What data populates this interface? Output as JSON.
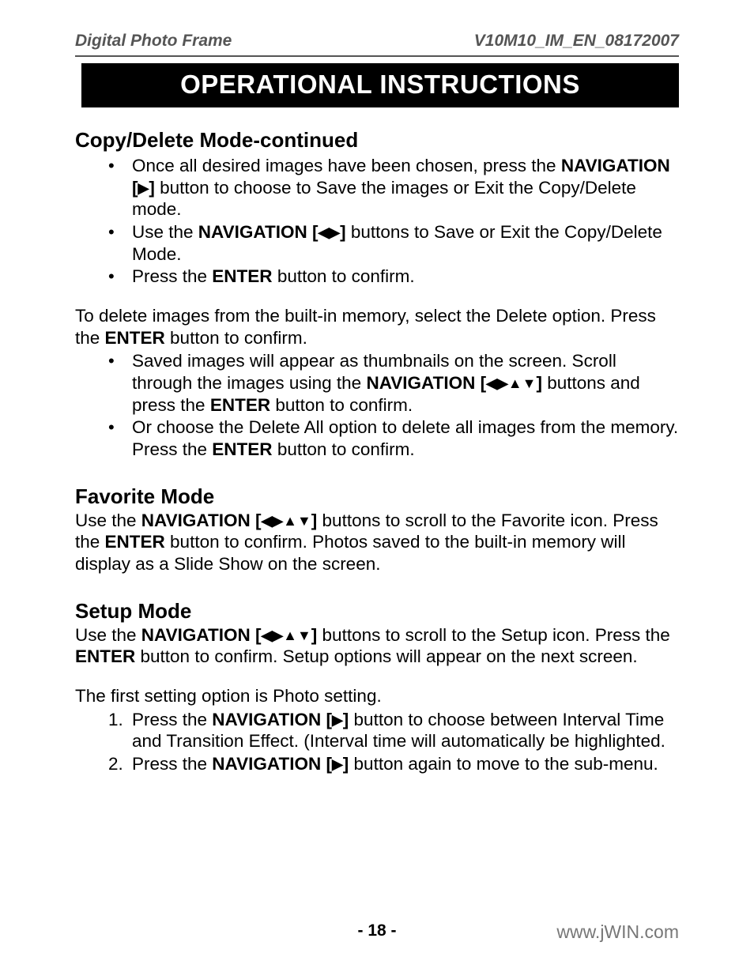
{
  "header": {
    "left": "Digital Photo Frame",
    "right": "V10M10_IM_EN_08172007"
  },
  "title": "OPERATIONAL INSTRUCTIONS",
  "s1": {
    "heading": "Copy/Delete Mode-continued",
    "b1a": "Once all desired images have been chosen, press the ",
    "b1b": "NAVIGATION [",
    "b1c": "]",
    "b1d": " button to choose to Save the images or Exit the Copy/Delete mode.",
    "b2a": "Use the ",
    "b2b": "NAVIGATION [",
    "b2c": "]",
    "b2d": " buttons to Save or Exit the Copy/Delete Mode.",
    "b3a": "Press the ",
    "b3b": "ENTER",
    "b3c": " button to confirm.",
    "p1a": "To delete images from the built-in memory, select the Delete option. Press the ",
    "p1b": "ENTER",
    "p1c": " button to confirm.",
    "b4a": "Saved images will appear as thumbnails on the screen. Scroll through the images using the ",
    "b4b": "NAVIGATION [",
    "b4c": "]",
    "b4d": " buttons and press the ",
    "b4e": "ENTER",
    "b4f": " button to confirm.",
    "b5a": "Or choose the Delete All option to delete all images from the memory. Press the ",
    "b5b": "ENTER",
    "b5c": " button to confirm."
  },
  "s2": {
    "heading": "Favorite Mode",
    "p1a": "Use the ",
    "p1b": "NAVIGATION [",
    "p1c": "]",
    "p1d": " buttons to scroll to the Favorite icon. Press the ",
    "p1e": "ENTER",
    "p1f": " button to confirm. Photos saved to the built-in memory will display as a Slide Show on the screen."
  },
  "s3": {
    "heading": "Setup Mode",
    "p1a": "Use the ",
    "p1b": "NAVIGATION [",
    "p1c": "]",
    "p1d": " buttons to scroll to the Setup icon. Press the ",
    "p1e": "ENTER",
    "p1f": " button to confirm. Setup options will appear on the next screen.",
    "p2": "The first setting option is Photo setting.",
    "n1num": "1.",
    "n1a": "Press the ",
    "n1b": "NAVIGATION [",
    "n1c": "]",
    "n1d": " button to choose between Interval Time and Transition Effect. (Interval time will automatically be highlighted.",
    "n2num": "2.",
    "n2a": "Press the ",
    "n2b": "NAVIGATION [",
    "n2c": "]",
    "n2d": " button again to move to the sub-menu."
  },
  "footer": {
    "page": "- 18 -",
    "url": "www.jWIN.com"
  },
  "tri": {
    "right": "▶",
    "left": "◀",
    "up": "▲",
    "down": "▼"
  }
}
